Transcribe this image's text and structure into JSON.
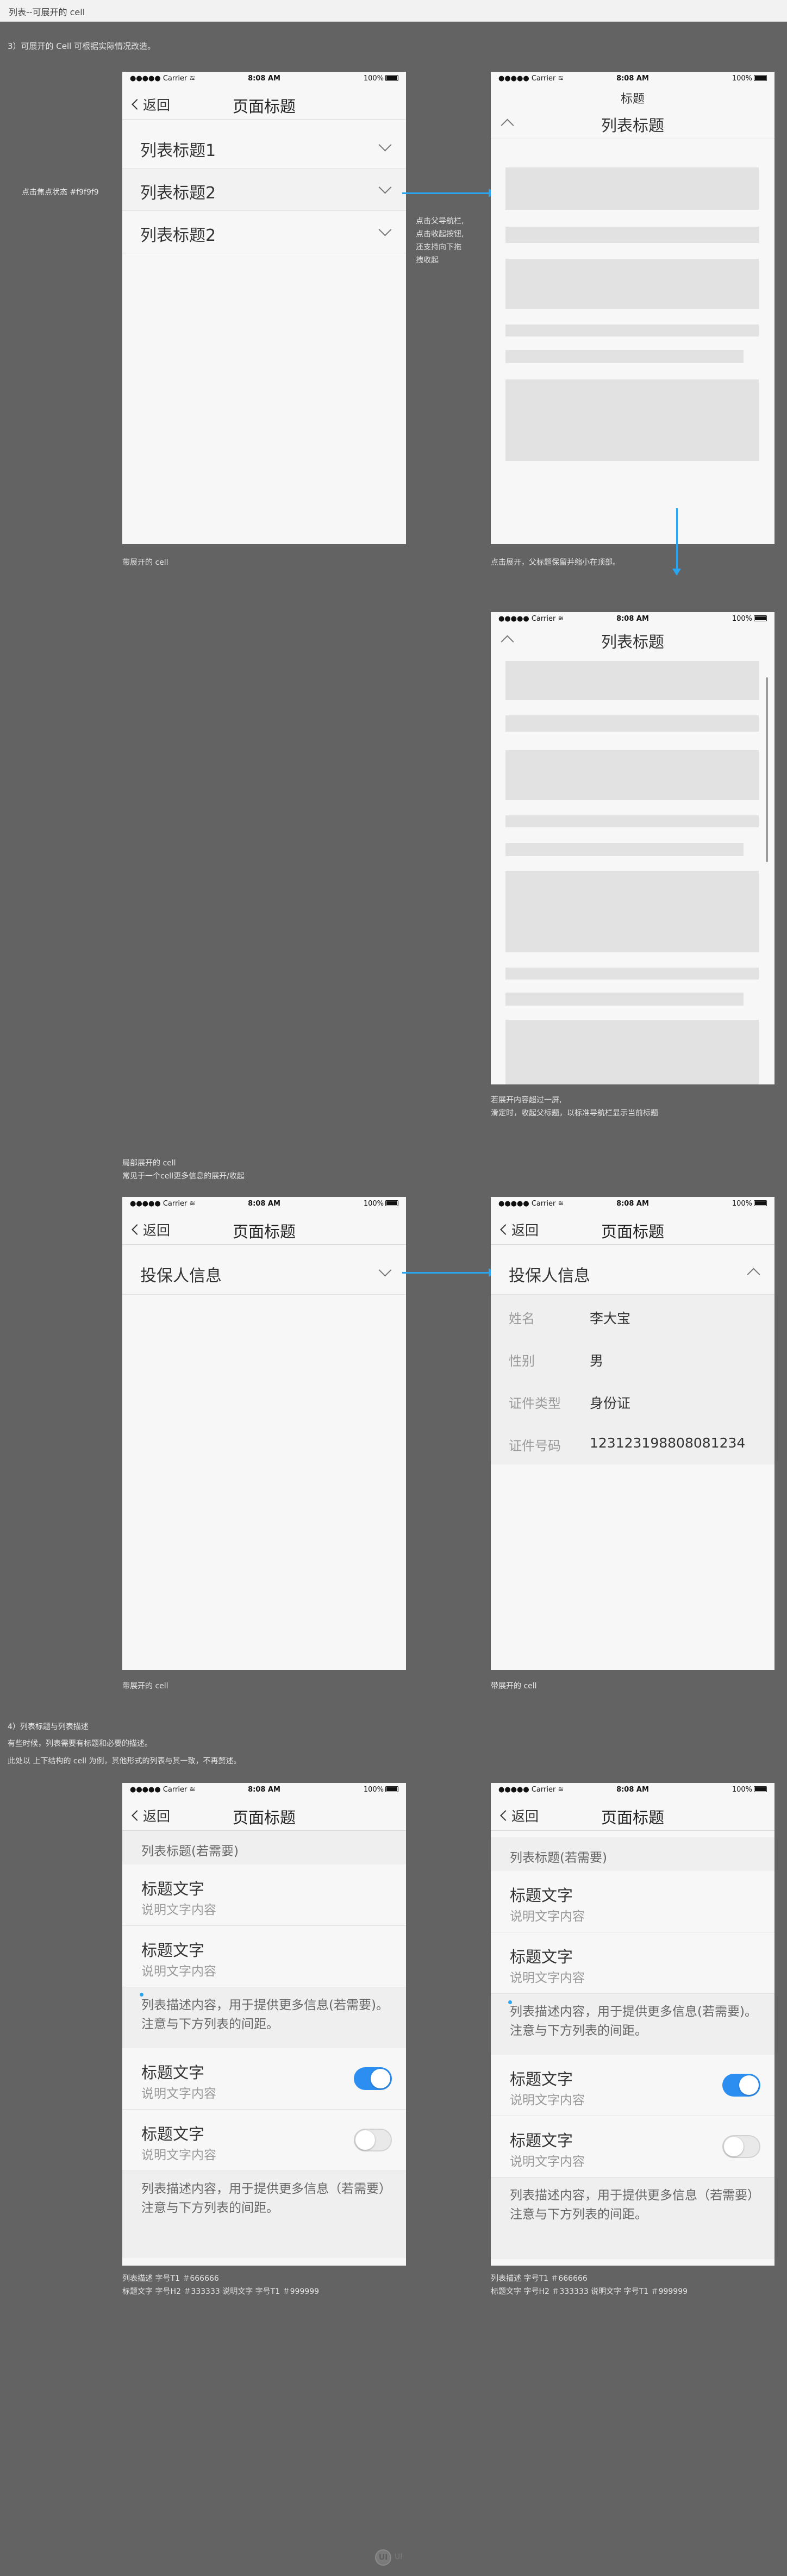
{
  "page": {
    "title": "列表--可展开的 cell"
  },
  "sections": {
    "s3": "3）可展开的 Cell 可根据实际情况改造。",
    "s4_title": "4）列表标题与列表描述",
    "s4_line2": "有些时候，列表需要有标题和必要的描述。",
    "s4_line3": "此处以 上下结构的 cell 为例，其他形式的列表与其一致，不再赘述。"
  },
  "status": {
    "carrier": "Carrier",
    "time": "8:08 AM",
    "battery": "100%"
  },
  "nav": {
    "back": "返回",
    "title": "页面标题",
    "small_title": "标题",
    "list_title": "列表标题"
  },
  "annotations": {
    "focus": "点击焦点状态  #f9f9f9",
    "tap_note_1": "点击父导航栏,",
    "tap_note_2": "点击收起按钮,",
    "tap_note_3": "还支持向下拖",
    "tap_note_4": "拽收起",
    "cap1": "带展开的 cell",
    "cap2": "点击展开，父标题保留并缩小在顶部。",
    "cap3_1": "若展开内容超过一屏,",
    "cap3_2": "滑定时，收起父标题，以标准导航栏显示当前标题",
    "mid_1": "局部展开的 cell",
    "mid_2": "常见于一个cell更多信息的展开/收起",
    "cap4": "带展开的 cell",
    "cap5": "带展开的 cell",
    "spec1_1": "列表描述 字号T1  ＃666666",
    "spec1_2": "标题文字 字号H2  ＃333333     说明文字 字号T1  ＃999999",
    "spec2_1": "列表描述 字号T1  ＃666666",
    "spec2_2": "标题文字 字号H2  ＃333333     说明文字 字号T1  ＃999999"
  },
  "list1": {
    "item1": "列表标题1",
    "item2": "列表标题2",
    "item3": "列表标题2"
  },
  "insured": {
    "header": "投保人信息",
    "fields": [
      {
        "k": "姓名",
        "v": "李大宝"
      },
      {
        "k": "性别",
        "v": "男"
      },
      {
        "k": "证件类型",
        "v": "身份证"
      },
      {
        "k": "证件号码",
        "v": "123123198808081234"
      }
    ]
  },
  "desc_list": {
    "group": "列表标题(若需要)",
    "cell_title": "标题文字",
    "cell_sub": "说明文字内容",
    "desc1": "列表描述内容，用于提供更多信息(若需要)。注意与下方列表的间距。",
    "desc2": "列表描述内容，用于提供更多信息（若需要）注意与下方列表的间距。"
  },
  "colors": {
    "accent": "#2aa6f0",
    "toggle_on": "#2d8ef2",
    "background": "#636363"
  },
  "footer": {
    "mark": "UI",
    "text": "UI"
  }
}
